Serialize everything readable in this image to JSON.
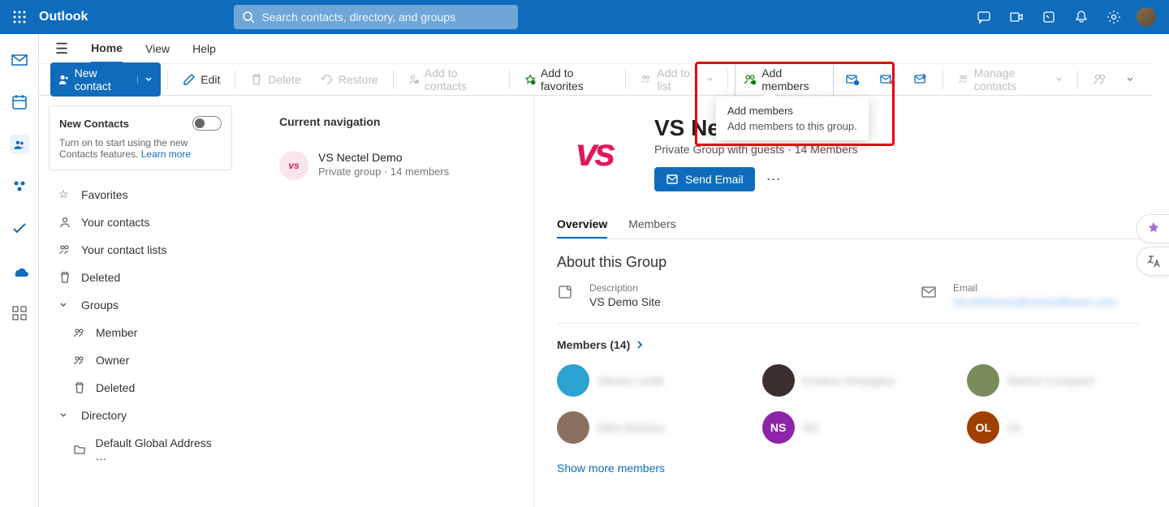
{
  "header": {
    "brand": "Outlook",
    "search_placeholder": "Search contacts, directory, and groups"
  },
  "tabs": {
    "home": "Home",
    "view": "View",
    "help": "Help"
  },
  "toolbar": {
    "new_contact": "New contact",
    "edit": "Edit",
    "delete": "Delete",
    "restore": "Restore",
    "add_to_contacts": "Add to contacts",
    "add_to_favorites": "Add to favorites",
    "add_to_list": "Add to list",
    "add_members": "Add members",
    "manage_contacts": "Manage contacts"
  },
  "tooltip": {
    "title": "Add members",
    "desc": "Add members to this group."
  },
  "col1": {
    "card_title": "New Contacts",
    "card_desc": "Turn on to start using the new Contacts features.",
    "learn_more": "Learn more",
    "favorites": "Favorites",
    "your_contacts": "Your contacts",
    "your_lists": "Your contact lists",
    "deleted": "Deleted",
    "groups": "Groups",
    "member": "Member",
    "owner": "Owner",
    "deleted2": "Deleted",
    "directory": "Directory",
    "default_gal": "Default Global Address …"
  },
  "col2": {
    "title": "Current navigation",
    "group_name": "VS Nectel Demo",
    "group_meta": "Private group  ·  14 members",
    "group_initials": "vs"
  },
  "detail": {
    "title": "VS Nectel Demo",
    "subtitle": "Private Group with guests · 14 Members",
    "send_email": "Send Email",
    "tab_overview": "Overview",
    "tab_members": "Members",
    "about_title": "About this Group",
    "desc_label": "Description",
    "desc_value": "VS Demo Site",
    "email_label": "Email",
    "email_value": "NectelDemo@virtosoftware.com",
    "members_title": "Members (14)",
    "show_more": "Show more members",
    "members": [
      {
        "name": "Alexey Livnik",
        "color": "#2aa3d1"
      },
      {
        "name": "Kristina Smyugina",
        "color": "#3a2e2e"
      },
      {
        "name": "Marina Conquest",
        "color": "#7a8a5a"
      },
      {
        "name": "Mike Butusov",
        "color": "#8a7060"
      },
      {
        "name": "NS",
        "color": "#8e24aa",
        "initials": "NS"
      },
      {
        "name": "OL",
        "color": "#a04000",
        "initials": "OL"
      }
    ]
  }
}
